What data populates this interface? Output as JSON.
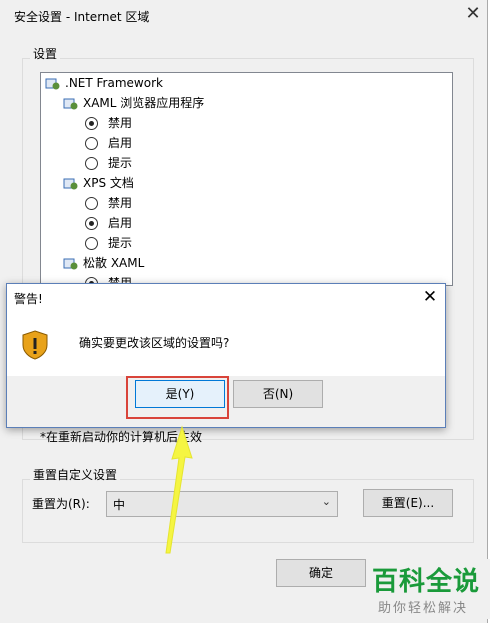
{
  "window": {
    "title": "安全设置 - Internet 区域",
    "close": "✕"
  },
  "settings": {
    "group_label": "设置",
    "tree": [
      {
        "kind": "folder",
        "label": ".NET Framework"
      },
      {
        "kind": "folder",
        "label": "XAML 浏览器应用程序"
      },
      {
        "kind": "radio",
        "label": "禁用",
        "checked": true
      },
      {
        "kind": "radio",
        "label": "启用",
        "checked": false
      },
      {
        "kind": "radio",
        "label": "提示",
        "checked": false
      },
      {
        "kind": "folder",
        "label": "XPS 文档"
      },
      {
        "kind": "radio",
        "label": "禁用",
        "checked": false
      },
      {
        "kind": "radio",
        "label": "启用",
        "checked": true
      },
      {
        "kind": "radio",
        "label": "提示",
        "checked": false
      },
      {
        "kind": "folder",
        "label": "松散 XAML"
      },
      {
        "kind": "radio",
        "label": "禁用",
        "checked": true
      }
    ],
    "restart_note": "*在重新启动你的计算机后生效"
  },
  "reset": {
    "group_label": "重置自定义设置",
    "reset_to_label": "重置为(R):",
    "reset_value": "中",
    "reset_button": "重置(E)..."
  },
  "footer": {
    "ok_button": "确定"
  },
  "dialog": {
    "title": "警告!",
    "close": "✕",
    "message": "确实要更改该区域的设置吗?",
    "yes_button": "是(Y)",
    "no_button": "否(N)"
  },
  "watermark": {
    "big": "百科全说",
    "small": "助你轻松解决"
  },
  "colors": {
    "highlight": "#d9443a",
    "arrow": "#f5f542",
    "watermark": "#1a9a3a"
  }
}
